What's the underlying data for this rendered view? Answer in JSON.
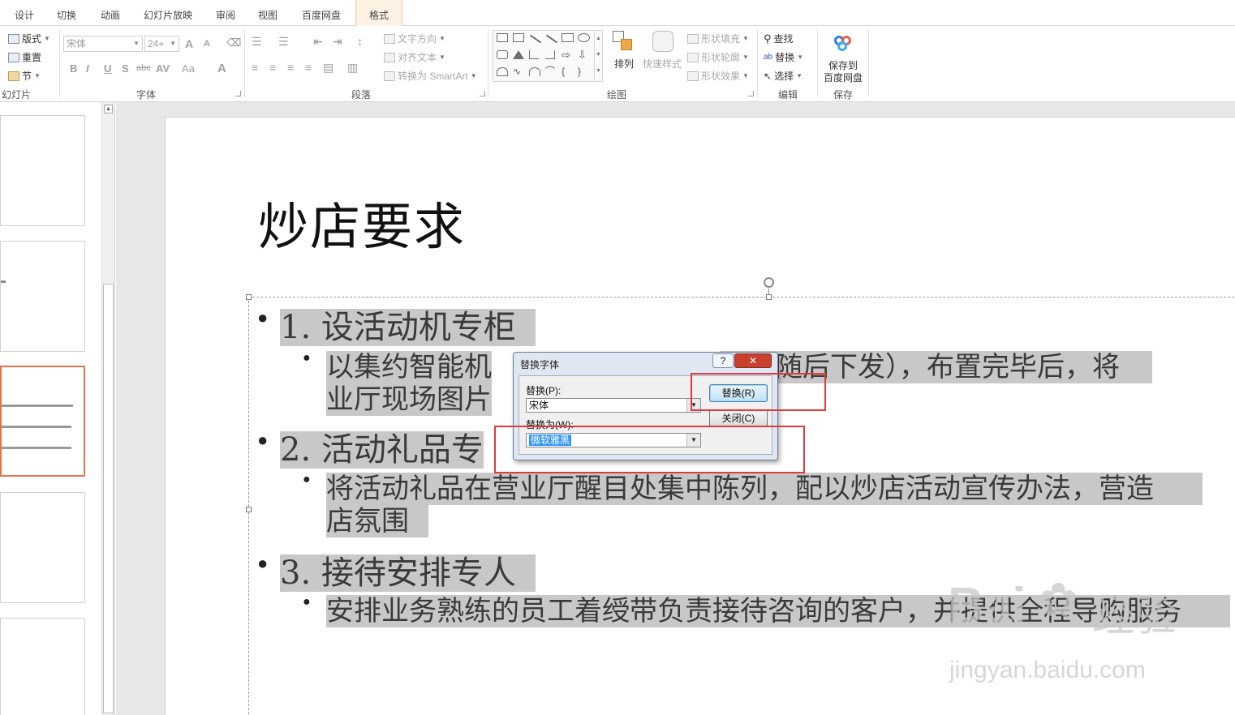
{
  "tabs": [
    "设计",
    "切换",
    "动画",
    "幻灯片放映",
    "审阅",
    "视图",
    "百度网盘",
    "格式"
  ],
  "ribbon": {
    "slides_group": {
      "layout": "版式",
      "reset": "重置",
      "section": "节",
      "label": "幻灯片"
    },
    "font_group": {
      "font_name": "宋体",
      "font_size": "24+",
      "label": "字体",
      "grow": "A",
      "shrink": "A",
      "bold": "B",
      "italic": "I",
      "underline": "U",
      "shadow": "S",
      "strike": "abc",
      "spacing": "AV",
      "case": "Aa",
      "color": "A"
    },
    "paragraph_group": {
      "text_direction": "文字方向",
      "align_text": "对齐文本",
      "smartart": "转换为 SmartArt",
      "label": "段落"
    },
    "drawing_group": {
      "arrange": "排列",
      "quick_styles": "快速样式",
      "shape_fill": "形状填充",
      "shape_outline": "形状轮廓",
      "shape_effects": "形状效果",
      "label": "绘图"
    },
    "editing_group": {
      "find": "查找",
      "replace": "替换",
      "select": "选择",
      "label": "编辑"
    },
    "save_group": {
      "save_line1": "保存到",
      "save_line2": "百度网盘",
      "label": "保存"
    }
  },
  "slide": {
    "title": "炒店要求",
    "lines": [
      {
        "level": 1,
        "text": "1. 设活动机专柜"
      },
      {
        "level": 2,
        "text": "以集约智能机",
        "text_b": "规范随后下发），布置完毕后，将"
      },
      {
        "level": 2,
        "text": "业厅现场图片"
      },
      {
        "level": 1,
        "text": "2. 活动礼品专"
      },
      {
        "level": 2,
        "text": "将活动礼品在营业厅醒目处集中陈列，配以炒店活动宣传办法，营造"
      },
      {
        "level": 2,
        "text": "店氛围"
      },
      {
        "level": 1,
        "text": "3. 接待安排专人"
      },
      {
        "level": 2,
        "text": "安排业务熟练的员工着绶带负责接待咨询的客户，并提供全程导购服务"
      }
    ]
  },
  "dialog": {
    "title": "替换字体",
    "help": "?",
    "close": "✕",
    "replace_label": "替换(P):",
    "replace_value": "宋体",
    "with_label": "替换为(W):",
    "with_value": "微软雅黑",
    "replace_button": "替换(R)",
    "close_button": "关闭(C)"
  },
  "watermark": {
    "brand": "Bai",
    "brand2": "经验",
    "url": "jingyan.baidu.com"
  }
}
